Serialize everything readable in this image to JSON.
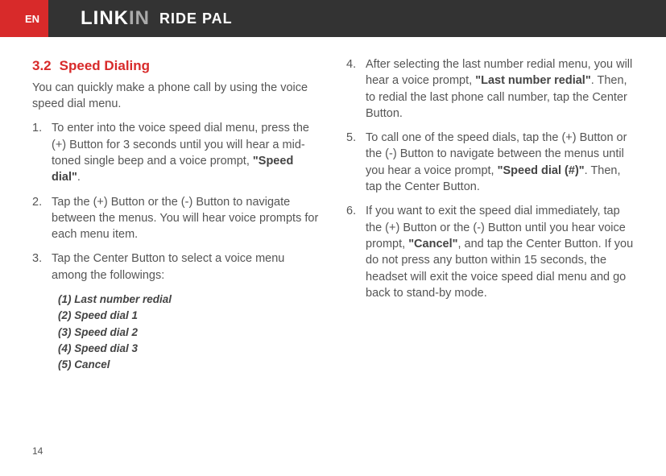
{
  "header": {
    "lang": "EN",
    "brand_main_a": "LINK",
    "brand_main_b": "IN",
    "brand_sub": "RIDE PAL"
  },
  "section": {
    "number": "3.2",
    "title": "Speed Dialing",
    "intro": "You can quickly make a phone call by using the voice speed dial menu."
  },
  "steps_left": {
    "s1": {
      "num": "1.",
      "text_a": "To enter into the voice speed dial menu, press the (+) Button for 3 seconds until you will hear a mid-toned single beep and a voice prompt, ",
      "bold": "\"Speed dial\"",
      "text_b": "."
    },
    "s2": {
      "num": "2.",
      "text": "Tap the (+) Button or the (-) Button to navigate between the menus. You will hear voice prompts for each menu item."
    },
    "s3": {
      "num": "3.",
      "text": "Tap the Center Button to select a voice menu among the followings:"
    }
  },
  "submenu": {
    "m1": "(1) Last number redial",
    "m2": "(2) Speed dial 1",
    "m3": "(3) Speed dial 2",
    "m4": "(4) Speed dial 3",
    "m5": "(5) Cancel"
  },
  "steps_right": {
    "s4": {
      "num": "4.",
      "text_a": "After selecting the last number redial menu, you will hear a voice prompt, ",
      "bold": "\"Last number redial\"",
      "text_b": ". Then, to redial the last phone call number, tap the Center Button."
    },
    "s5": {
      "num": "5.",
      "text_a": "To call one of the speed dials, tap the (+) Button or the (-) Button to navigate between the menus until you hear a voice prompt, ",
      "bold": "\"Speed dial (#)\"",
      "text_b": ". Then, tap the Center Button."
    },
    "s6": {
      "num": "6.",
      "text_a": "If you want to exit the speed dial immediately, tap the (+) Button or the (-) Button until you hear voice prompt, ",
      "bold": "\"Cancel\"",
      "text_b": ", and tap the Center Button. If you do not press any button within 15 seconds, the headset will exit the voice speed dial menu and go back to stand-by mode."
    }
  },
  "page_number": "14"
}
